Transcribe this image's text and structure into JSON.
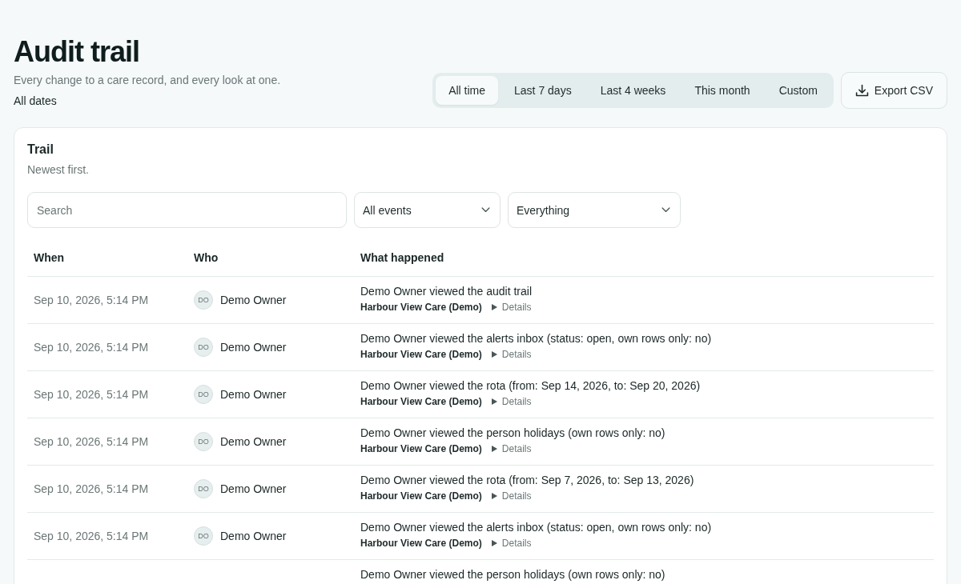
{
  "header": {
    "title": "Audit trail",
    "subtitle": "Every change to a care record, and every look at one.",
    "range_label": "All dates"
  },
  "range_tabs": [
    {
      "label": "All time",
      "selected": true
    },
    {
      "label": "Last 7 days",
      "selected": false
    },
    {
      "label": "Last 4 weeks",
      "selected": false
    },
    {
      "label": "This month",
      "selected": false
    },
    {
      "label": "Custom",
      "selected": false
    }
  ],
  "export_button": {
    "label": "Export CSV"
  },
  "trail": {
    "title": "Trail",
    "subtitle": "Newest first.",
    "search": {
      "placeholder": "Search"
    },
    "filters": [
      {
        "value": "All events"
      },
      {
        "value": "Everything"
      }
    ],
    "table": {
      "columns": [
        "When",
        "Who",
        "What happened"
      ],
      "rows": [
        {
          "when": "Sep 10, 2026, 5:14 PM",
          "who": {
            "initials": "DO",
            "name": "Demo Owner"
          },
          "what": "Demo Owner viewed the audit trail",
          "org": "Harbour View Care (Demo)",
          "details": {
            "label": "Details",
            "expanded": false
          }
        },
        {
          "when": "Sep 10, 2026, 5:14 PM",
          "who": {
            "initials": "DO",
            "name": "Demo Owner"
          },
          "what": "Demo Owner viewed the alerts inbox (status: open, own rows only: no)",
          "org": "Harbour View Care (Demo)",
          "details": {
            "label": "Details",
            "expanded": false
          }
        },
        {
          "when": "Sep 10, 2026, 5:14 PM",
          "who": {
            "initials": "DO",
            "name": "Demo Owner"
          },
          "what": "Demo Owner viewed the rota (from: Sep 14, 2026, to: Sep 20, 2026)",
          "org": "Harbour View Care (Demo)",
          "details": {
            "label": "Details",
            "expanded": false
          }
        },
        {
          "when": "Sep 10, 2026, 5:14 PM",
          "who": {
            "initials": "DO",
            "name": "Demo Owner"
          },
          "what": "Demo Owner viewed the person holidays (own rows only: no)",
          "org": "Harbour View Care (Demo)",
          "details": {
            "label": "Details",
            "expanded": false
          }
        },
        {
          "when": "Sep 10, 2026, 5:14 PM",
          "who": {
            "initials": "DO",
            "name": "Demo Owner"
          },
          "what": "Demo Owner viewed the rota (from: Sep 7, 2026, to: Sep 13, 2026)",
          "org": "Harbour View Care (Demo)",
          "details": {
            "label": "Details",
            "expanded": false
          }
        },
        {
          "when": "Sep 10, 2026, 5:14 PM",
          "who": {
            "initials": "DO",
            "name": "Demo Owner"
          },
          "what": "Demo Owner viewed the alerts inbox (status: open, own rows only: no)",
          "org": "Harbour View Care (Demo)",
          "details": {
            "label": "Details",
            "expanded": false
          }
        },
        {
          "what": "Demo Owner viewed the person holidays (own rows only: no)"
        }
      ]
    }
  }
}
